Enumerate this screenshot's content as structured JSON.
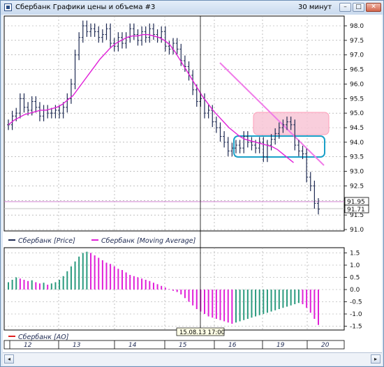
{
  "window": {
    "title": "Сбербанк Графики цены и объема #3",
    "interval": "30 минут",
    "buttons": {
      "minimize": "–",
      "maximize": "□",
      "close": "✕"
    }
  },
  "price_panel": {
    "y_ticks": [
      "98.0",
      "97.5",
      "97.0",
      "96.5",
      "96.0",
      "95.5",
      "95.0",
      "94.5",
      "94.0",
      "93.5",
      "93.0",
      "92.5",
      "92.0",
      "91.5",
      "91.0"
    ],
    "price_box_upper": "91.95",
    "price_box_lower": "91.71",
    "colors": {
      "price": "#1e2a52",
      "ma": "#e020d8",
      "trendline": "#f07ae8",
      "highlight_fill": "#f8c6d6",
      "highlight_stroke": "#ff8fae",
      "box_stroke": "#1aa0c8",
      "ref_line": "#d080d0"
    }
  },
  "legend": {
    "price_label": "Сбербанк [Price]",
    "ma_label": "Сбербанк [Moving Average]",
    "ao_label": "Сбербанк [AO]"
  },
  "ao_panel": {
    "y_ticks": [
      "1.5",
      "1.0",
      "0.5",
      "0.0",
      "-0.5",
      "-1.0",
      "-1.5"
    ],
    "colors": {
      "up": "#2a9a7e",
      "down": "#e020d8"
    }
  },
  "cursor_label": "15.08.13 17:00",
  "x_axis": {
    "days": [
      "12",
      "13",
      "14",
      "15",
      "16",
      "19",
      "20"
    ]
  },
  "scrollbar": {
    "left": "◂",
    "right": "▸"
  },
  "chart_data": [
    {
      "type": "candlestick",
      "title": "",
      "series": [
        {
          "name": "Сбербанк [Price]",
          "values": [
            94.6,
            94.9,
            95.0,
            95.5,
            95.2,
            95.1,
            95.4,
            95.2,
            94.9,
            95.1,
            95.0,
            95.0,
            95.1,
            95.0,
            95.2,
            95.5,
            96.0,
            97.0,
            97.6,
            98.0,
            97.8,
            97.9,
            97.8,
            97.6,
            97.7,
            97.9,
            97.4,
            97.3,
            97.6,
            97.4,
            97.6,
            97.9,
            97.7,
            97.5,
            97.8,
            97.6,
            97.9,
            97.7,
            97.6,
            97.8,
            97.3,
            97.2,
            97.4,
            97.2,
            96.8,
            96.6,
            96.3,
            95.8,
            95.4,
            95.5,
            95.0,
            95.1,
            94.7,
            94.5,
            94.2,
            94.0,
            93.7,
            93.8,
            93.9,
            93.8,
            94.2,
            94.0,
            93.9,
            93.8,
            94.0,
            93.5,
            93.9,
            94.1,
            94.3,
            94.5,
            94.6,
            94.7,
            94.6,
            93.9,
            93.7,
            93.6,
            92.8,
            92.5,
            91.9,
            91.7
          ]
        },
        {
          "name": "Сбербанк [Moving Average]",
          "values": [
            94.6,
            94.75,
            94.85,
            94.95,
            95.0,
            95.05,
            95.1,
            95.1,
            95.15,
            95.2,
            95.3,
            95.45,
            95.6,
            95.85,
            96.1,
            96.35,
            96.6,
            96.85,
            97.05,
            97.25,
            97.4,
            97.5,
            97.6,
            97.65,
            97.65,
            97.7,
            97.7,
            97.65,
            97.6,
            97.5,
            97.35,
            97.1,
            96.8,
            96.5,
            96.2,
            95.9,
            95.6,
            95.35,
            95.1,
            94.9,
            94.7,
            94.5,
            94.35,
            94.2,
            94.1,
            94.05,
            94.0,
            93.95,
            93.9,
            93.85,
            93.75,
            93.6,
            93.45,
            93.3
          ]
        }
      ],
      "ylim": [
        91.0,
        98.0
      ]
    },
    {
      "type": "bar",
      "title": "",
      "series": [
        {
          "name": "Сбербанк [AO]",
          "values": [
            0.3,
            0.4,
            0.5,
            0.45,
            0.4,
            0.35,
            0.38,
            0.3,
            0.25,
            0.28,
            0.2,
            0.25,
            0.3,
            0.4,
            0.55,
            0.75,
            0.95,
            1.15,
            1.35,
            1.5,
            1.55,
            1.5,
            1.4,
            1.3,
            1.2,
            1.1,
            1.05,
            0.95,
            0.85,
            0.8,
            0.7,
            0.6,
            0.55,
            0.5,
            0.45,
            0.4,
            0.35,
            0.28,
            0.22,
            0.15,
            0.08,
            0.02,
            -0.05,
            -0.1,
            -0.2,
            -0.35,
            -0.5,
            -0.65,
            -0.8,
            -0.9,
            -1.0,
            -1.1,
            -1.15,
            -1.2,
            -1.25,
            -1.3,
            -1.35,
            -1.4,
            -1.35,
            -1.3,
            -1.25,
            -1.2,
            -1.15,
            -1.1,
            -1.05,
            -1.0,
            -0.95,
            -0.9,
            -0.85,
            -0.8,
            -0.75,
            -0.7,
            -0.65,
            -0.6,
            -0.55,
            -0.6,
            -0.75,
            -0.95,
            -1.2,
            -1.45
          ]
        }
      ],
      "ylim": [
        -1.6,
        1.6
      ]
    }
  ]
}
